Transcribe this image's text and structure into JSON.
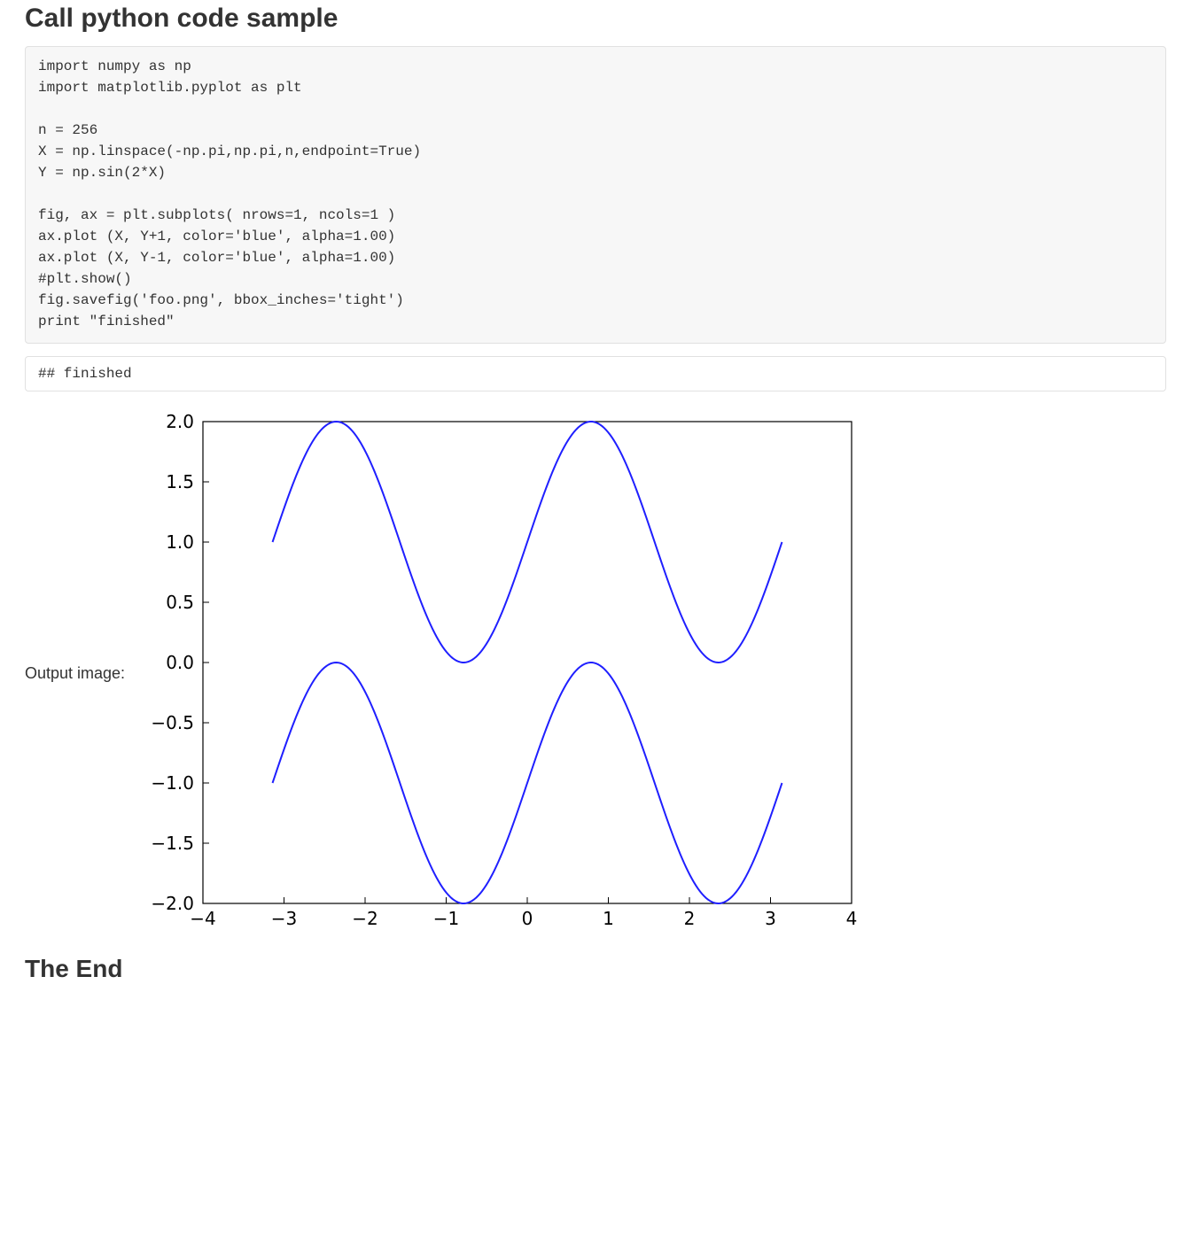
{
  "heading": "Call python code sample",
  "code_block": "import numpy as np\nimport matplotlib.pyplot as plt\n\nn = 256\nX = np.linspace(-np.pi,np.pi,n,endpoint=True)\nY = np.sin(2*X)\n\nfig, ax = plt.subplots( nrows=1, ncols=1 )\nax.plot (X, Y+1, color='blue', alpha=1.00)\nax.plot (X, Y-1, color='blue', alpha=1.00)\n#plt.show()\nfig.savefig('foo.png', bbox_inches='tight')\nprint \"finished\"",
  "stdout_block": "## finished",
  "output_image_label": "Output image:",
  "footer": "The End",
  "chart_data": {
    "type": "line",
    "xlabel": "",
    "ylabel": "",
    "title": "",
    "xlim": [
      -4,
      4
    ],
    "ylim": [
      -2,
      2
    ],
    "xticks": [
      -4,
      -3,
      -2,
      -1,
      0,
      1,
      2,
      3,
      4
    ],
    "yticks": [
      -2.0,
      -1.5,
      -1.0,
      -0.5,
      0.0,
      0.5,
      1.0,
      1.5,
      2.0
    ],
    "x_domain": [
      -3.14159265,
      3.14159265
    ],
    "n_points": 256,
    "series": [
      {
        "name": "sin(2x)+1",
        "formula": "sin(2*x)+1",
        "color": "#1f1fff"
      },
      {
        "name": "sin(2x)-1",
        "formula": "sin(2*x)-1",
        "color": "#1f1fff"
      }
    ]
  }
}
